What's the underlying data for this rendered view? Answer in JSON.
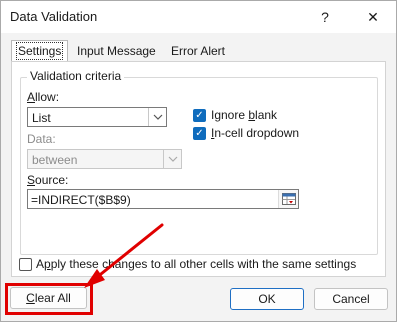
{
  "window": {
    "title": "Data Validation",
    "help_glyph": "?",
    "close_glyph": "✕"
  },
  "tabs": [
    {
      "label": "Settings",
      "active": true
    },
    {
      "label": "Input Message",
      "active": false
    },
    {
      "label": "Error Alert",
      "active": false
    }
  ],
  "criteria": {
    "group_label": "Validation criteria",
    "allow_label": "Allow:",
    "allow_value": "List",
    "data_label": "Data:",
    "data_value": "between",
    "ignore_blank_label": "Ignore blank",
    "ignore_blank_checked": true,
    "in_cell_dropdown_label": "In-cell dropdown",
    "in_cell_dropdown_checked": true,
    "source_label": "Source:",
    "source_value": "=INDIRECT($B$9)"
  },
  "apply_all": {
    "label": "Apply these changes to all other cells with the same settings",
    "checked": false
  },
  "buttons": {
    "clear_all": "Clear All",
    "ok": "OK",
    "cancel": "Cancel"
  },
  "annotation": {
    "color": "#e00000",
    "icons": [
      "arrow-annotation-icon",
      "highlight-box"
    ]
  },
  "colors": {
    "accent": "#0f6cbd",
    "annotation_red": "#e00000"
  }
}
